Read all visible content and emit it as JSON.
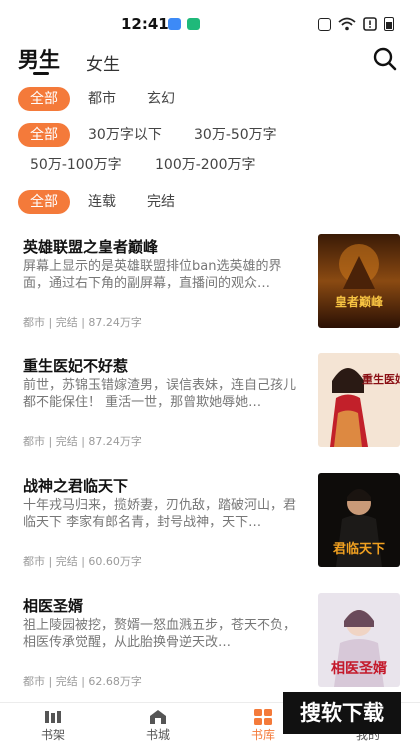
{
  "status_bar": {
    "time": "12:41"
  },
  "header": {
    "tabs": [
      {
        "label": "男生",
        "active": true
      },
      {
        "label": "女生",
        "active": false
      }
    ],
    "search_icon": "search-icon"
  },
  "filters": {
    "category": [
      "全部",
      "都市",
      "玄幻"
    ],
    "word_count": [
      "全部",
      "30万字以下",
      "30万-50万字",
      "50万-100万字",
      "100万-200万字"
    ],
    "status": [
      "全部",
      "连载",
      "完结"
    ]
  },
  "books": [
    {
      "title": "英雄联盟之皇者巅峰",
      "desc": "屏幕上显示的是英雄联盟排位ban选英雄的界面，通过右下角的副屏幕，直播间的观众…",
      "meta": "都市 | 完结 | 87.24万字",
      "cover_text": "皇者巅峰"
    },
    {
      "title": "重生医妃不好惹",
      "desc": "前世，苏锦玉错嫁渣男，误信表妹，连自己孩儿都不能保住！ 重活一世，那曾欺她辱她…",
      "meta": "都市 | 完结 | 87.24万字",
      "cover_text": "重生医妃"
    },
    {
      "title": "战神之君临天下",
      "desc": "十年戎马归来，揽娇妻，刃仇敌，踏破河山，君临天下 李家有郎名青，封号战神，天下…",
      "meta": "都市 | 完结 | 60.60万字",
      "cover_text": "君临天下"
    },
    {
      "title": "相医圣婿",
      "desc": "祖上陵园被挖，赘婿一怒血溅五步，苍天不负，相医传承觉醒，从此胎换骨逆天改…",
      "meta": "都市 | 完结 | 62.68万字",
      "cover_text": "相医圣婿"
    }
  ],
  "bottom_nav": [
    {
      "label": "书架",
      "icon": "bookshelf-icon",
      "active": false
    },
    {
      "label": "书城",
      "icon": "bookstore-icon",
      "active": false
    },
    {
      "label": "书库",
      "icon": "library-icon",
      "active": true
    },
    {
      "label": "我的",
      "icon": "profile-icon",
      "active": false
    }
  ],
  "watermark": "搜软下载",
  "colors": {
    "accent": "#f47a3a",
    "text": "#222222",
    "muted": "#777777"
  }
}
